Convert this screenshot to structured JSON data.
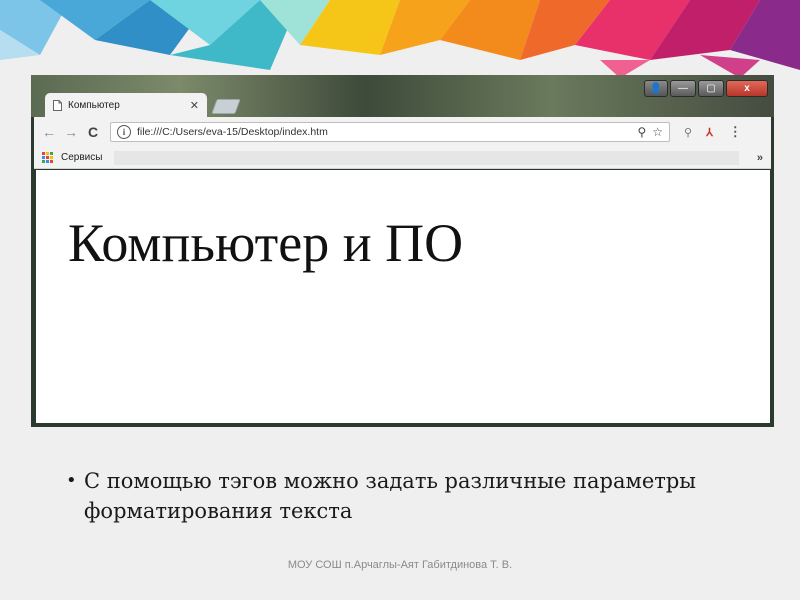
{
  "browser": {
    "tab": {
      "title": "Компьютер",
      "close_glyph": "✕"
    },
    "window_controls": {
      "user": "👤",
      "minimize": "—",
      "maximize": "▢",
      "close": "x"
    },
    "toolbar": {
      "back_glyph": "←",
      "forward_glyph": "→",
      "reload_glyph": "C",
      "info_glyph": "i",
      "url": "file:///C:/Users/eva-15/Desktop/index.htm",
      "zoom_glyph": "⚲",
      "star_glyph": "☆",
      "search_ext_glyph": "⚲",
      "pdf_ext_glyph": "⅄",
      "menu_glyph": "⋮"
    },
    "bookmarks": {
      "apps_label": "Сервисы",
      "more_glyph": "»"
    }
  },
  "page": {
    "heading": "Компьютер и ПО"
  },
  "slide": {
    "bullets": [
      "С помощью тэгов можно задать различные параметры форматирования текста"
    ],
    "footer": "МОУ СОШ п.Арчаглы-Аят Габитдинова Т. В."
  },
  "colors": {
    "accent_pink": "#e8306a",
    "accent_orange": "#f7a21b",
    "accent_teal": "#3fb9c8",
    "accent_purple": "#8a2a8a"
  }
}
